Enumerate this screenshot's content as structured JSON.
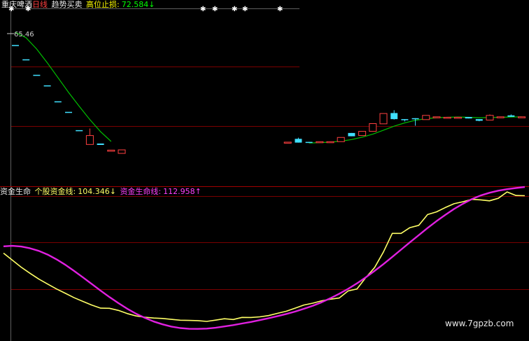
{
  "header_top": {
    "stock_name": "重庆啤酒",
    "period": "日线",
    "indicator": "趋势买卖",
    "stop_label": "高位止损:",
    "stop_value": "72.584",
    "stop_arrow": "↓"
  },
  "header_bottom": {
    "indicator": "资金生命",
    "line1_label": "个股资金线:",
    "line1_value": "104.346",
    "line1_arrow": "↓",
    "line2_label": "资金生命线:",
    "line2_value": "112.958",
    "line2_arrow": "↑"
  },
  "watermark": "www.7gpzb.com",
  "colors": {
    "background": "#000000",
    "up_candle": "#ff4040",
    "down_candle": "#40e0ff",
    "ma_line": "#00c000",
    "fund_line": "#ffff66",
    "life_line": "#e020e0",
    "grid": "#7a0000",
    "axis": "#606060"
  },
  "chart_data": [
    {
      "type": "candlestick",
      "title": "趋势买卖",
      "annotations": [
        {
          "text": "65.46"
        }
      ],
      "candles": [
        {
          "o": 60.6,
          "c": 60.6,
          "h": 60.6,
          "l": 60.6,
          "dir": "down"
        },
        {
          "o": 54.5,
          "c": 54.5,
          "h": 54.5,
          "l": 54.5,
          "dir": "down"
        },
        {
          "o": 47.9,
          "c": 47.9,
          "h": 47.9,
          "l": 47.9,
          "dir": "down"
        },
        {
          "o": 43.4,
          "c": 43.4,
          "h": 43.4,
          "l": 43.4,
          "dir": "down"
        },
        {
          "o": 36.6,
          "c": 36.6,
          "h": 36.6,
          "l": 36.6,
          "dir": "down"
        },
        {
          "o": 32.1,
          "c": 32.1,
          "h": 32.1,
          "l": 32.1,
          "dir": "down"
        },
        {
          "o": 24.3,
          "c": 24.3,
          "h": 24.3,
          "l": 24.3,
          "dir": "down"
        },
        {
          "o": 18.2,
          "c": 22.0,
          "h": 25.0,
          "l": 18.2,
          "dir": "up"
        },
        {
          "o": 18.6,
          "c": 18.0,
          "h": 18.6,
          "l": 18.0,
          "dir": "down"
        },
        {
          "o": 15.3,
          "c": 15.8,
          "h": 15.8,
          "l": 15.3,
          "dir": "up"
        },
        {
          "o": 14.4,
          "c": 15.9,
          "h": 15.9,
          "l": 14.4,
          "dir": "up"
        },
        {
          "o": 19.2,
          "c": 19.2,
          "h": 19.2,
          "l": 19.2,
          "dir": "up"
        },
        {
          "o": 20.6,
          "c": 19.0,
          "h": 21.1,
          "l": 19.0,
          "dir": "down"
        },
        {
          "o": 19.1,
          "c": 19.3,
          "h": 19.3,
          "l": 19.1,
          "dir": "down"
        },
        {
          "o": 19.3,
          "c": 19.4,
          "h": 19.4,
          "l": 19.0,
          "dir": "up"
        },
        {
          "o": 19.4,
          "c": 19.4,
          "h": 19.4,
          "l": 19.4,
          "dir": "up"
        },
        {
          "o": 19.4,
          "c": 21.2,
          "h": 21.2,
          "l": 19.4,
          "dir": "up"
        },
        {
          "o": 23.1,
          "c": 21.7,
          "h": 23.1,
          "l": 21.7,
          "dir": "down"
        },
        {
          "o": 22.0,
          "c": 23.8,
          "h": 23.8,
          "l": 22.0,
          "dir": "up"
        },
        {
          "o": 23.8,
          "c": 27.1,
          "h": 27.1,
          "l": 23.8,
          "dir": "up"
        },
        {
          "o": 27.0,
          "c": 31.4,
          "h": 31.4,
          "l": 27.0,
          "dir": "up"
        },
        {
          "o": 31.6,
          "c": 29.0,
          "h": 32.8,
          "l": 28.8,
          "dir": "down"
        },
        {
          "o": 29.0,
          "c": 28.6,
          "h": 29.0,
          "l": 28.0,
          "dir": "down"
        },
        {
          "o": 29.4,
          "c": 29.0,
          "h": 29.4,
          "l": 26.2,
          "dir": "down"
        },
        {
          "o": 28.8,
          "c": 30.6,
          "h": 30.6,
          "l": 28.8,
          "dir": "up"
        },
        {
          "o": 30.0,
          "c": 30.0,
          "h": 30.0,
          "l": 30.0,
          "dir": "up"
        },
        {
          "o": 29.8,
          "c": 29.8,
          "h": 29.8,
          "l": 29.8,
          "dir": "up"
        },
        {
          "o": 29.8,
          "c": 29.8,
          "h": 29.8,
          "l": 29.8,
          "dir": "up"
        },
        {
          "o": 29.9,
          "c": 29.3,
          "h": 29.9,
          "l": 29.3,
          "dir": "down"
        },
        {
          "o": 29.0,
          "c": 28.3,
          "h": 29.0,
          "l": 28.1,
          "dir": "down"
        },
        {
          "o": 28.6,
          "c": 30.6,
          "h": 31.0,
          "l": 28.6,
          "dir": "up"
        },
        {
          "o": 30.0,
          "c": 30.0,
          "h": 30.0,
          "l": 30.0,
          "dir": "up"
        },
        {
          "o": 30.6,
          "c": 30.0,
          "h": 31.0,
          "l": 30.0,
          "dir": "down"
        },
        {
          "o": 30.0,
          "c": 30.0,
          "h": 30.0,
          "l": 30.0,
          "dir": "up"
        }
      ],
      "ma_segments": [
        [
          [
            0,
            66.0
          ],
          [
            1,
            63.7
          ],
          [
            2,
            58.9
          ],
          [
            3,
            53.0
          ],
          [
            4,
            46.7
          ],
          [
            5,
            40.4
          ],
          [
            6,
            34.5
          ],
          [
            7,
            28.8
          ],
          [
            8,
            23.7
          ],
          [
            9,
            19.5
          ]
        ],
        [
          [
            13,
            18.8
          ],
          [
            14,
            19.0
          ],
          [
            15,
            19.2
          ],
          [
            16,
            19.6
          ],
          [
            17,
            20.3
          ],
          [
            18,
            21.3
          ],
          [
            19,
            22.6
          ],
          [
            20,
            24.3
          ],
          [
            21,
            26.0
          ],
          [
            22,
            27.4
          ],
          [
            23,
            28.5
          ],
          [
            24,
            29.2
          ],
          [
            25,
            29.6
          ],
          [
            26,
            29.8
          ],
          [
            27,
            29.9
          ],
          [
            28,
            29.8
          ],
          [
            29,
            29.6
          ],
          [
            30,
            29.7
          ],
          [
            31,
            29.8
          ],
          [
            32,
            29.9
          ],
          [
            33,
            30.0
          ]
        ]
      ]
    },
    {
      "type": "line",
      "title": "资金生命",
      "x_count": 60,
      "series": [
        {
          "name": "个股资金线",
          "values": [
            85.8,
            79.2,
            72.5,
            66.7,
            61.2,
            56.5,
            51.9,
            47.8,
            43.6,
            40.1,
            36.6,
            33.7,
            33.6,
            31.6,
            28.6,
            26.4,
            25.1,
            24.4,
            24.0,
            23.1,
            22.3,
            22.1,
            21.9,
            21.2,
            22.4,
            23.7,
            23.0,
            25.0,
            24.9,
            25.5,
            26.7,
            28.8,
            30.8,
            33.7,
            36.7,
            38.4,
            40.7,
            42.2,
            43.3,
            50.0,
            51.9,
            62.6,
            72.1,
            86.9,
            104.5,
            104.5,
            109.9,
            112.1,
            122.3,
            124.8,
            128.9,
            132.6,
            134.4,
            136.7,
            136.2,
            135.3,
            137.7,
            143.7,
            140.3,
            140.1
          ]
        },
        {
          "name": "资金生命线",
          "values": [
            92.2,
            92.7,
            92.0,
            90.4,
            87.9,
            84.4,
            79.9,
            74.7,
            68.9,
            62.8,
            56.5,
            50.2,
            44.2,
            38.5,
            33.2,
            28.5,
            24.6,
            21.1,
            18.4,
            16.3,
            14.9,
            14.2,
            14.1,
            14.4,
            15.2,
            16.4,
            17.7,
            19.2,
            20.7,
            22.4,
            24.2,
            26.1,
            28.2,
            30.5,
            33.1,
            36.0,
            39.3,
            43.1,
            47.3,
            52.0,
            57.2,
            62.9,
            69.0,
            75.4,
            82.2,
            89.1,
            96.0,
            102.8,
            109.6,
            116.0,
            122.0,
            127.6,
            132.5,
            136.9,
            140.3,
            142.9,
            144.9,
            146.3,
            147.4,
            148.4
          ]
        }
      ]
    }
  ]
}
